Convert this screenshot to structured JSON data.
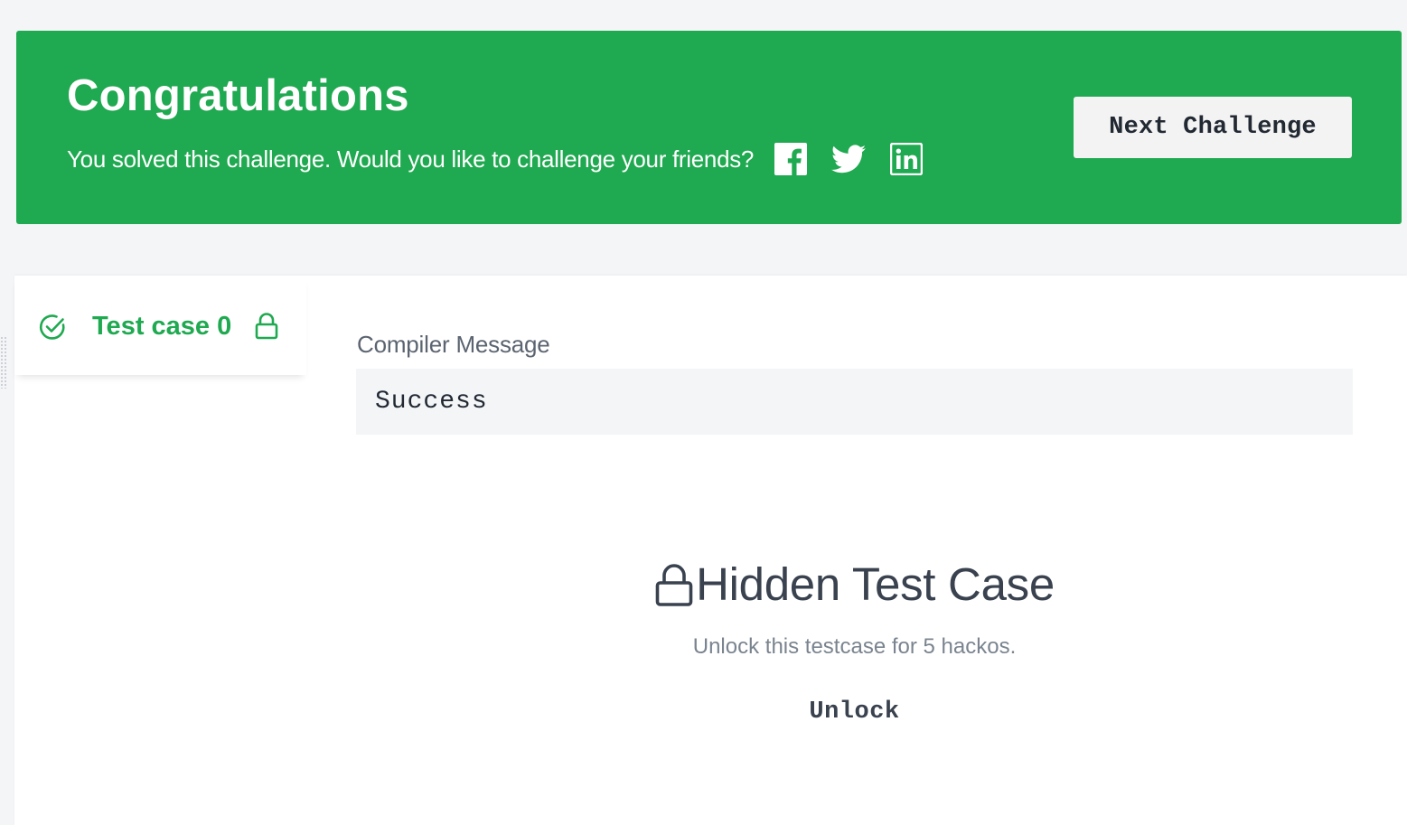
{
  "banner": {
    "title": "Congratulations",
    "subtitle": "You solved this challenge. Would you like to challenge your friends?",
    "social_icons": [
      "facebook-icon",
      "twitter-icon",
      "linkedin-icon"
    ],
    "next_button_label": "Next Challenge",
    "bg_color": "#1fa950"
  },
  "testcases": {
    "tabs": [
      {
        "label": "Test case 0",
        "status": "passed",
        "locked": true
      }
    ]
  },
  "result": {
    "compiler_label": "Compiler Message",
    "compiler_message": "Success"
  },
  "hidden": {
    "title": "Hidden Test Case",
    "subtitle": "Unlock this testcase for 5 hackos.",
    "unlock_label": "Unlock"
  },
  "colors": {
    "accent": "#1fa950",
    "text_dark": "#39424e",
    "text_muted": "#7a848f",
    "panel_bg": "#f3f5f7"
  }
}
